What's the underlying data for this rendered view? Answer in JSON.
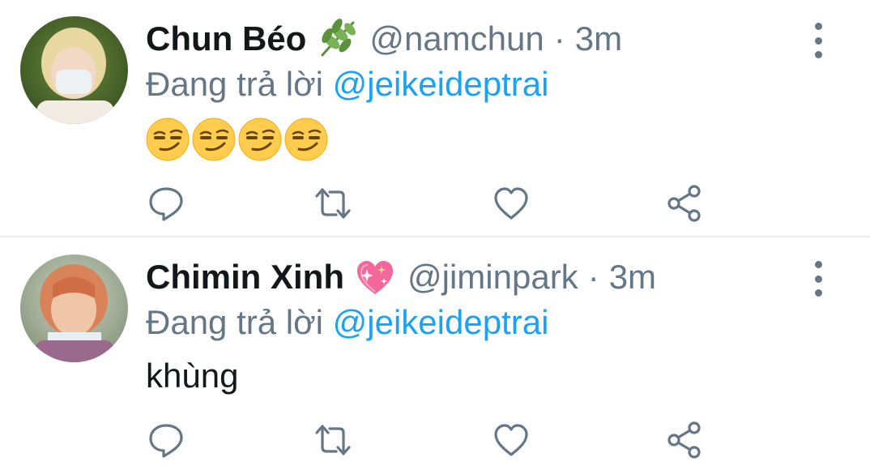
{
  "tweets": [
    {
      "display_name": "Chun Béo",
      "name_emoji": "herb",
      "handle": "@namchun",
      "separator": "·",
      "time": "3m",
      "replying_prefix": "Đang trả lời",
      "replying_to": "@jeikeideptrai",
      "body_text": "",
      "body_emoji": [
        "smirking-face",
        "smirking-face",
        "smirking-face",
        "smirking-face"
      ]
    },
    {
      "display_name": "Chimin Xinh",
      "name_emoji": "sparkling-heart",
      "handle": "@jiminpark",
      "separator": "·",
      "time": "3m",
      "replying_prefix": "Đang trả lời",
      "replying_to": "@jeikeideptrai",
      "body_text": "khùng",
      "body_emoji": []
    }
  ],
  "actions": [
    "reply-icon",
    "retweet-icon",
    "like-icon",
    "share-icon"
  ],
  "colors": {
    "name": "#14171a",
    "muted": "#657786",
    "link": "#1da1f2",
    "divider": "#e6ecf0"
  }
}
